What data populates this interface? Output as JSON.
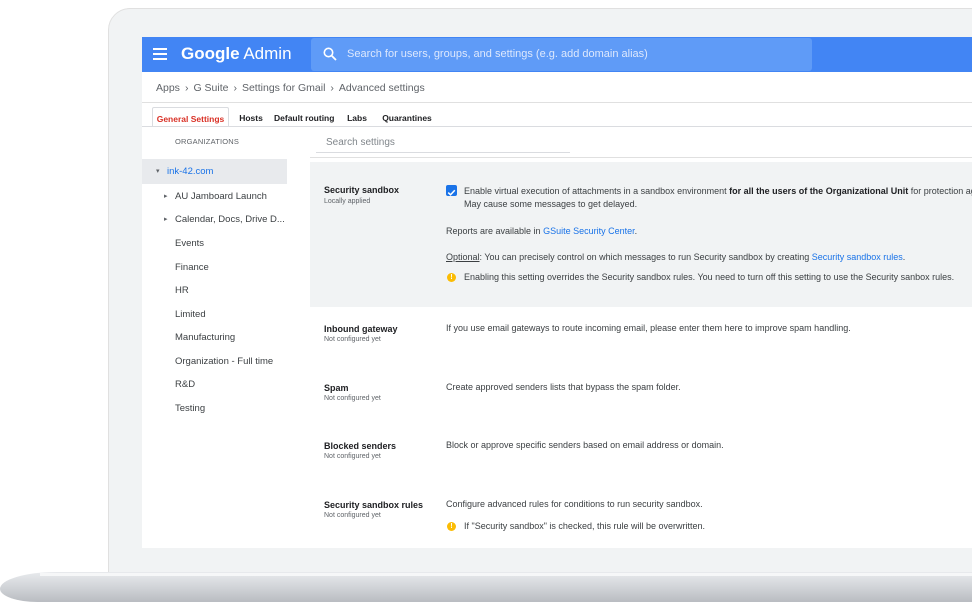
{
  "topbar": {
    "brand_google": "Google",
    "brand_admin": " Admin",
    "search_placeholder": "Search for users, groups, and settings (e.g. add domain alias)"
  },
  "breadcrumb": [
    "Apps",
    "G Suite",
    "Settings for Gmail",
    "Advanced settings"
  ],
  "tabs": [
    "General Settings",
    "Hosts",
    "Default routing",
    "Labs",
    "Quarantines"
  ],
  "active_tab": "General Settings",
  "org_panel": {
    "header": "ORGANIZATIONS",
    "items": [
      {
        "label": "ink-42.com",
        "expander": "▾",
        "selected": true
      },
      {
        "label": "AU Jamboard Launch",
        "expander": "▸"
      },
      {
        "label": "Calendar, Docs, Drive D...",
        "expander": "▸"
      },
      {
        "label": "Events"
      },
      {
        "label": "Finance"
      },
      {
        "label": "HR"
      },
      {
        "label": "Limited"
      },
      {
        "label": "Manufacturing"
      },
      {
        "label": "Organization - Full time"
      },
      {
        "label": "R&D"
      },
      {
        "label": "Testing"
      }
    ]
  },
  "settings_search_placeholder": "Search settings",
  "sections": {
    "security_sandbox": {
      "title": "Security sandbox",
      "status": "Locally applied",
      "checked": true,
      "line1_a": "Enable virtual execution of attachments in a sandbox environment ",
      "line1_b": "for all the users of the Organizational Unit",
      "line1_c": " for protection ag",
      "line2": "May cause some messages to get delayed.",
      "reports_a": "Reports are available in ",
      "reports_link": "GSuite Security Center",
      "reports_b": ".",
      "optional_label": "Optional",
      "optional_text": ": You can precisely control on which messages to run Security sandbox by creating ",
      "optional_link": "Security sandbox rules",
      "optional_end": ".",
      "warning": "Enabling this setting overrides the Security sandbox rules. You need to turn off this setting to use the Security sanbox rules."
    },
    "inbound_gateway": {
      "title": "Inbound gateway",
      "status": "Not configured yet",
      "text": "If you use email gateways to route incoming email, please enter them here to improve spam handling."
    },
    "spam": {
      "title": "Spam",
      "status": "Not configured yet",
      "text": "Create approved senders lists that bypass the spam folder."
    },
    "blocked_senders": {
      "title": "Blocked senders",
      "status": "Not configured yet",
      "text": "Block or approve specific senders based on email address or domain."
    },
    "sandbox_rules": {
      "title": "Security sandbox rules",
      "status": "Not configured yet",
      "text": "Configure advanced rules for conditions to run security sandbox.",
      "warning": "If \"Security sandbox\" is checked, this rule will be overwritten."
    }
  },
  "colors": {
    "topbar": "#4285f4",
    "active_tab": "#d93025",
    "link": "#1a73e8",
    "warning": "#fbbc04"
  }
}
